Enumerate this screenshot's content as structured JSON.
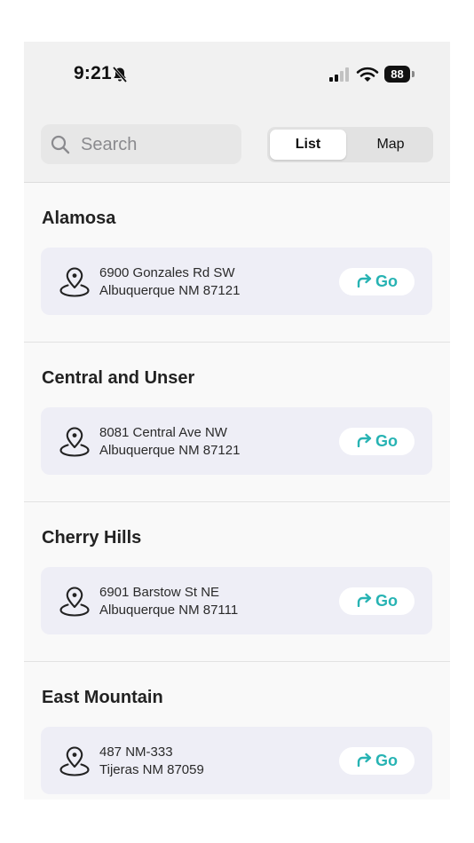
{
  "status_bar": {
    "time": "9:21",
    "battery": "88",
    "icons": [
      "bell-slash-icon",
      "signal-icon",
      "wifi-icon",
      "battery-icon"
    ]
  },
  "search": {
    "placeholder": "Search",
    "icon": "search-icon"
  },
  "view_toggle": {
    "options": [
      "List",
      "Map"
    ],
    "selected": "List"
  },
  "colors": {
    "accent": "#27b3b3",
    "card_bg": "#eeeef6"
  },
  "locations": [
    {
      "name": "Alamosa",
      "address_line1": "6900 Gonzales Rd SW",
      "address_line2": "Albuquerque NM 87121",
      "go_label": "Go"
    },
    {
      "name": "Central and Unser",
      "address_line1": "8081 Central Ave NW",
      "address_line2": "Albuquerque NM 87121",
      "go_label": "Go"
    },
    {
      "name": "Cherry Hills",
      "address_line1": "6901 Barstow St NE",
      "address_line2": "Albuquerque NM 87111",
      "go_label": "Go"
    },
    {
      "name": "East Mountain",
      "address_line1": "487 NM-333",
      "address_line2": "Tijeras NM 87059",
      "go_label": "Go"
    }
  ]
}
